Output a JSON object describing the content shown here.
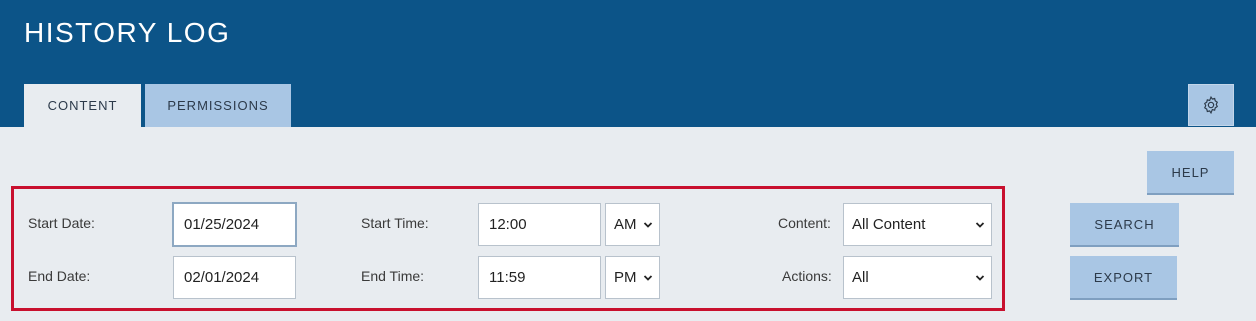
{
  "header": {
    "title": "HISTORY LOG",
    "tabs": [
      {
        "label": "CONTENT",
        "active": true
      },
      {
        "label": "PERMISSIONS",
        "active": false
      }
    ],
    "settings_icon": "gear-icon"
  },
  "actions": {
    "help_label": "HELP",
    "search_label": "SEARCH",
    "export_label": "EXPORT"
  },
  "filters": {
    "start_date": {
      "label": "Start Date:",
      "value": "01/25/2024"
    },
    "end_date": {
      "label": "End Date:",
      "value": "02/01/2024"
    },
    "start_time": {
      "label": "Start Time:",
      "value": "12:00",
      "meridiem": "AM"
    },
    "end_time": {
      "label": "End Time:",
      "value": "11:59",
      "meridiem": "PM"
    },
    "content": {
      "label": "Content:",
      "selected": "All Content"
    },
    "actions": {
      "label": "Actions:",
      "selected": "All"
    }
  },
  "colors": {
    "header_bg": "#0c5488",
    "page_bg": "#e8ecf0",
    "button_bg": "#a9c6e4",
    "highlight_border": "#c8102e"
  }
}
